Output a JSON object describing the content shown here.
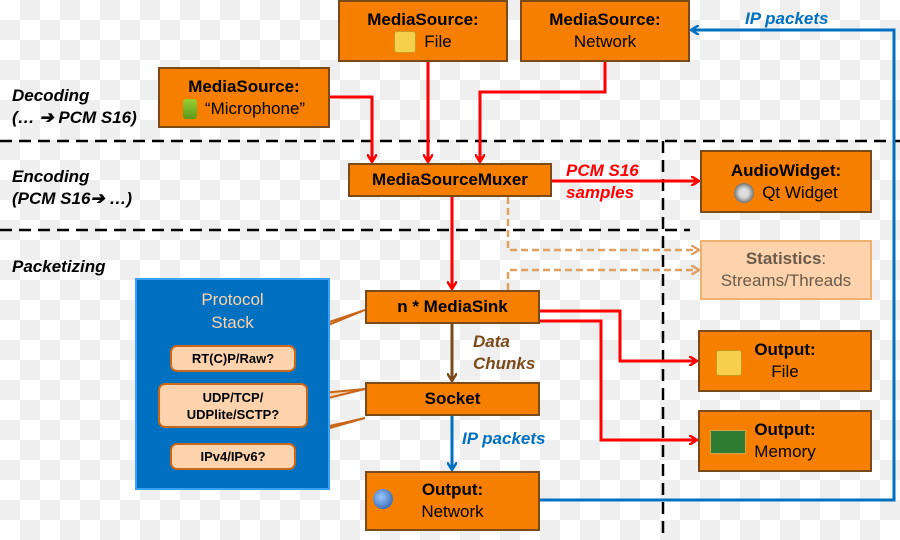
{
  "layers": {
    "decoding": {
      "title": "Decoding",
      "sub": "(… ➔ PCM S16)"
    },
    "encoding": {
      "title": "Encoding",
      "sub": "(PCM S16➔ …)"
    },
    "packetizing": {
      "title": "Packetizing"
    }
  },
  "nodes": {
    "source_file": {
      "title": "MediaSource:",
      "sub": "File",
      "icon": "package-icon"
    },
    "source_network": {
      "title": "MediaSource:",
      "sub": "Network"
    },
    "source_mic": {
      "title": "MediaSource:",
      "sub": "“Microphone”",
      "icon": "microphone-icon"
    },
    "muxer": {
      "title": "MediaSourceMuxer"
    },
    "audio_widget": {
      "title": "AudioWidget:",
      "sub": "Qt Widget",
      "icon": "speaker-icon"
    },
    "statistics": {
      "title": "Statistics",
      "title_suffix": ":",
      "sub": "Streams/Threads"
    },
    "media_sink": {
      "title": "n * MediaSink"
    },
    "socket": {
      "title": "Socket"
    },
    "output_network": {
      "title": "Output:",
      "sub": "Network",
      "icon": "network-globe-icon"
    },
    "output_file": {
      "title": "Output:",
      "sub": "File",
      "icon": "package-icon"
    },
    "output_memory": {
      "title": "Output:",
      "sub": "Memory",
      "icon": "memory-chip-icon"
    }
  },
  "edge_labels": {
    "pcm": [
      "PCM S16",
      "samples"
    ],
    "data_chunks": [
      "Data",
      "Chunks"
    ],
    "ip_packets_socket": "IP packets",
    "ip_packets_top": "IP packets"
  },
  "protocol_stack": {
    "title": [
      "Protocol",
      "Stack"
    ],
    "callouts": [
      "RT(C)P/Raw?",
      "UDP/TCP/\nUDPlite/SCTP?",
      "IPv4/IPv6?"
    ]
  },
  "colors": {
    "box": "#f77f00",
    "flow": "#ff0000",
    "ip": "#0070c0",
    "data": "#7a4a1a",
    "stats": "#e0a060"
  }
}
